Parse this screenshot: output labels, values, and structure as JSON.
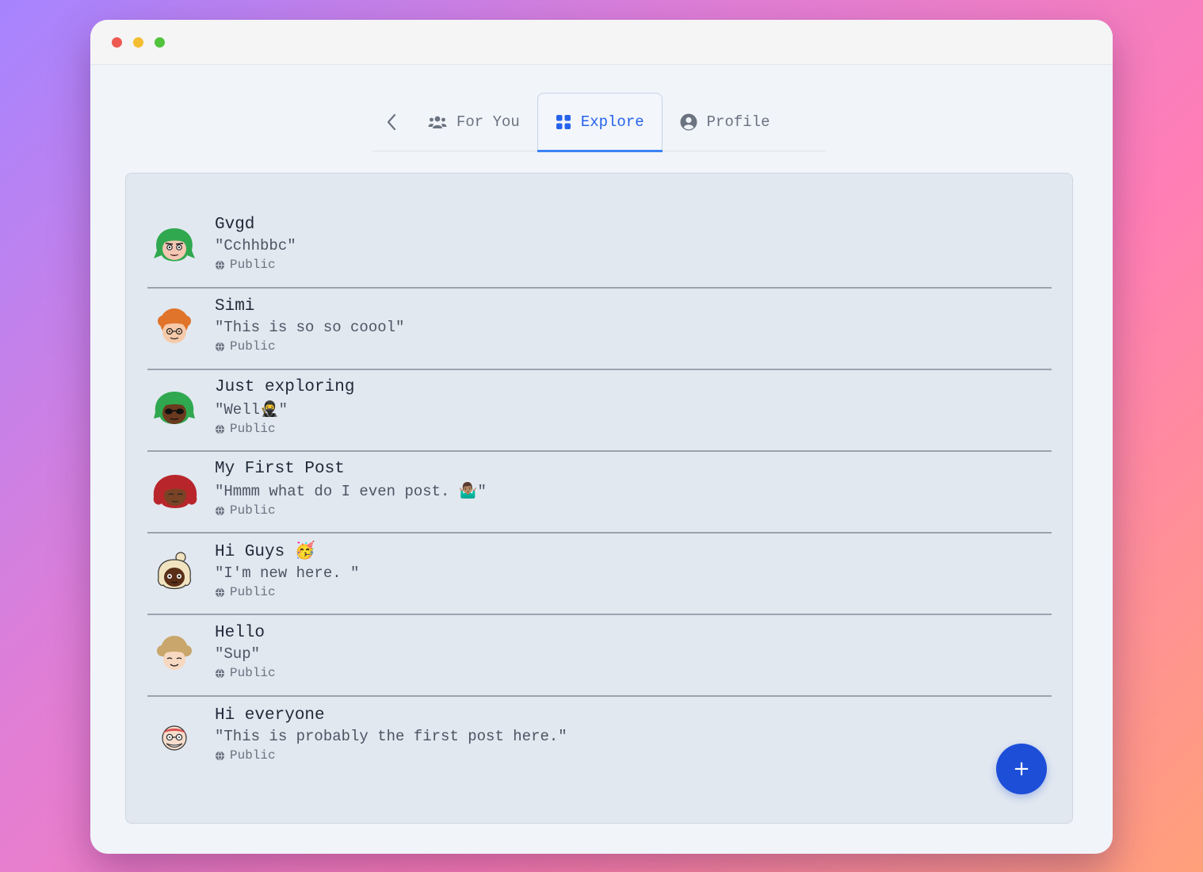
{
  "nav": {
    "tabs": [
      {
        "label": "For You",
        "icon": "users-icon"
      },
      {
        "label": "Explore",
        "icon": "grid-icon"
      },
      {
        "label": "Profile",
        "icon": "user-circle-icon"
      }
    ],
    "active_tab": "Explore"
  },
  "posts": [
    {
      "title": "Gvgd",
      "text": "\"Cchhbbc\"",
      "visibility": "Public",
      "avatar": "avatar-green-hair"
    },
    {
      "title": "Simi",
      "text": "\"This is so so coool\"",
      "visibility": "Public",
      "avatar": "avatar-orange-curly"
    },
    {
      "title": "Just exploring",
      "text": "\"Well🥷\"",
      "visibility": "Public",
      "avatar": "avatar-green-sunglasses"
    },
    {
      "title": "My First Post",
      "text": "\"Hmmm what do I even post. 🤷🏽‍♂️\"",
      "visibility": "Public",
      "avatar": "avatar-red-hair"
    },
    {
      "title": "Hi Guys 🥳",
      "text": "\"I'm new here. \"",
      "visibility": "Public",
      "avatar": "avatar-bun-hair"
    },
    {
      "title": "Hello",
      "text": "\"Sup\"",
      "visibility": "Public",
      "avatar": "avatar-blond-curly"
    },
    {
      "title": "Hi everyone",
      "text": "\"This is probably the first post here.\"",
      "visibility": "Public",
      "avatar": "avatar-old-glasses"
    }
  ],
  "fab": {
    "label": "+"
  },
  "colors": {
    "accent": "#2563eb",
    "fab": "#1d4ed8",
    "panel": "#e2e8f0"
  }
}
